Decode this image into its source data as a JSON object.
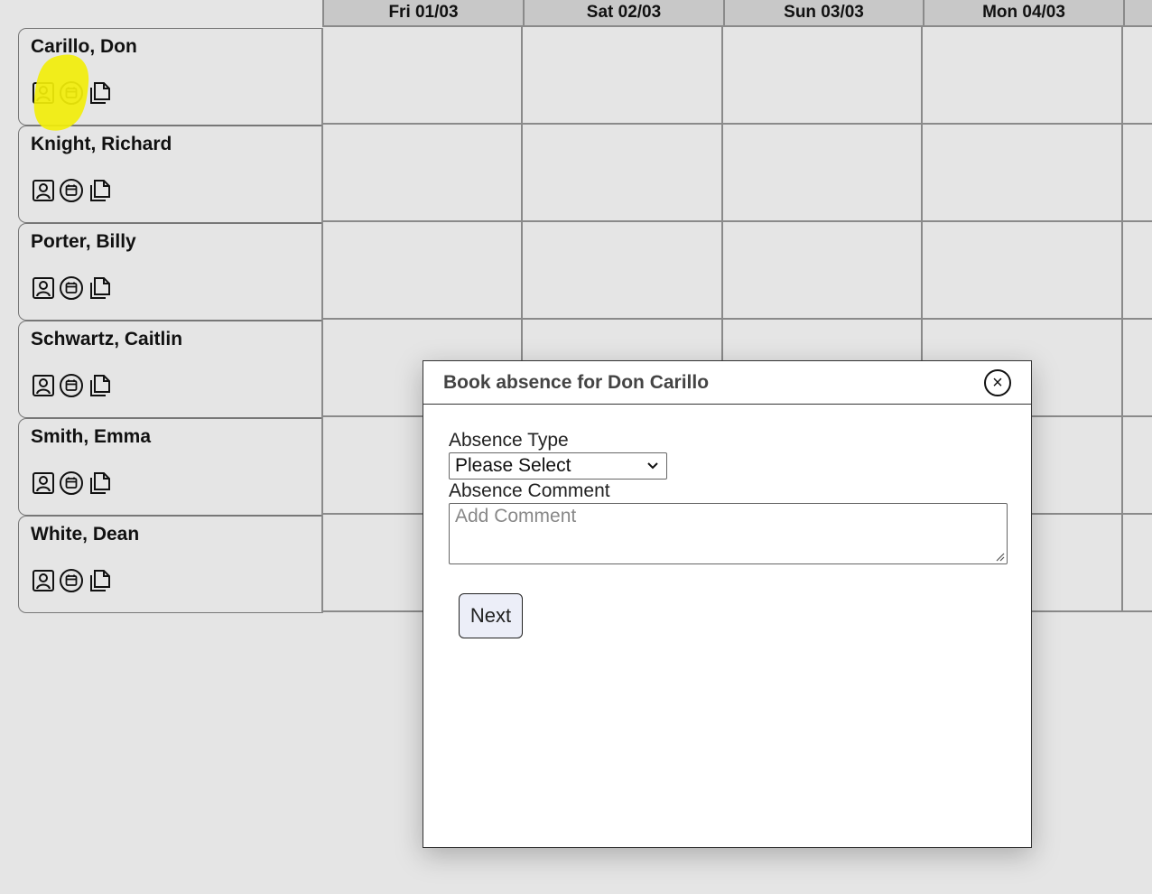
{
  "calendar": {
    "days": [
      "Fri 01/03",
      "Sat 02/03",
      "Sun 03/03",
      "Mon 04/03"
    ]
  },
  "employees": [
    {
      "name": "Carillo, Don"
    },
    {
      "name": "Knight, Richard"
    },
    {
      "name": "Porter, Billy"
    },
    {
      "name": "Schwartz, Caitlin"
    },
    {
      "name": "Smith, Emma"
    },
    {
      "name": "White, Dean"
    }
  ],
  "employee_icons": [
    "person-icon",
    "calendar-icon",
    "document-icon"
  ],
  "highlight_color": "#f2ee0a",
  "modal": {
    "title": "Book absence for Don Carillo",
    "close_symbol": "×",
    "absence_type_label": "Absence Type",
    "absence_type_value": "Please Select",
    "absence_comment_label": "Absence Comment",
    "absence_comment_placeholder": "Add Comment",
    "next_label": "Next"
  }
}
